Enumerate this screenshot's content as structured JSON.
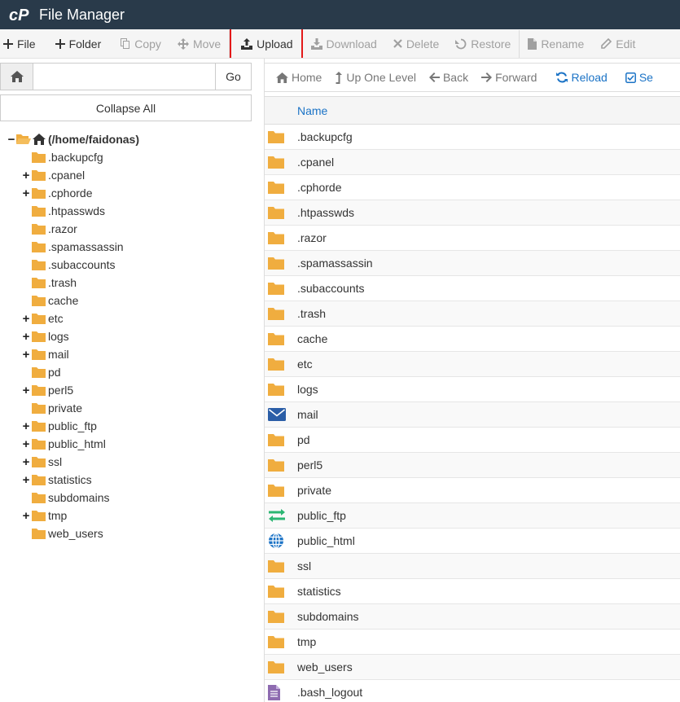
{
  "app": {
    "title": "File Manager"
  },
  "toolbar": {
    "file": "File",
    "folder": "Folder",
    "copy": "Copy",
    "move": "Move",
    "upload": "Upload",
    "download": "Download",
    "delete": "Delete",
    "restore": "Restore",
    "rename": "Rename",
    "edit": "Edit"
  },
  "search": {
    "go": "Go",
    "value": ""
  },
  "collapse_all": "Collapse All",
  "tree": {
    "root": "(/home/faidonas)",
    "items": [
      {
        "label": ".backupcfg",
        "expandable": false
      },
      {
        "label": ".cpanel",
        "expandable": true
      },
      {
        "label": ".cphorde",
        "expandable": true
      },
      {
        "label": ".htpasswds",
        "expandable": false
      },
      {
        "label": ".razor",
        "expandable": false
      },
      {
        "label": ".spamassassin",
        "expandable": false
      },
      {
        "label": ".subaccounts",
        "expandable": false
      },
      {
        "label": ".trash",
        "expandable": false
      },
      {
        "label": "cache",
        "expandable": false
      },
      {
        "label": "etc",
        "expandable": true
      },
      {
        "label": "logs",
        "expandable": true
      },
      {
        "label": "mail",
        "expandable": true
      },
      {
        "label": "pd",
        "expandable": false
      },
      {
        "label": "perl5",
        "expandable": true
      },
      {
        "label": "private",
        "expandable": false
      },
      {
        "label": "public_ftp",
        "expandable": true
      },
      {
        "label": "public_html",
        "expandable": true
      },
      {
        "label": "ssl",
        "expandable": true
      },
      {
        "label": "statistics",
        "expandable": true
      },
      {
        "label": "subdomains",
        "expandable": false
      },
      {
        "label": "tmp",
        "expandable": true
      },
      {
        "label": "web_users",
        "expandable": false
      }
    ]
  },
  "nav": {
    "home": "Home",
    "up": "Up One Level",
    "back": "Back",
    "forward": "Forward",
    "reload": "Reload",
    "select": "Se"
  },
  "table": {
    "header_name": "Name",
    "rows": [
      {
        "name": ".backupcfg",
        "icon": "folder-icon"
      },
      {
        "name": ".cpanel",
        "icon": "folder-icon"
      },
      {
        "name": ".cphorde",
        "icon": "folder-icon"
      },
      {
        "name": ".htpasswds",
        "icon": "folder-icon"
      },
      {
        "name": ".razor",
        "icon": "folder-icon"
      },
      {
        "name": ".spamassassin",
        "icon": "folder-icon"
      },
      {
        "name": ".subaccounts",
        "icon": "folder-icon"
      },
      {
        "name": ".trash",
        "icon": "folder-icon"
      },
      {
        "name": "cache",
        "icon": "folder-icon"
      },
      {
        "name": "etc",
        "icon": "folder-icon"
      },
      {
        "name": "logs",
        "icon": "folder-icon"
      },
      {
        "name": "mail",
        "icon": "mail-icon"
      },
      {
        "name": "pd",
        "icon": "folder-icon"
      },
      {
        "name": "perl5",
        "icon": "folder-icon"
      },
      {
        "name": "private",
        "icon": "folder-icon"
      },
      {
        "name": "public_ftp",
        "icon": "ftp-arrows-icon"
      },
      {
        "name": "public_html",
        "icon": "globe-icon"
      },
      {
        "name": "ssl",
        "icon": "folder-icon"
      },
      {
        "name": "statistics",
        "icon": "folder-icon"
      },
      {
        "name": "subdomains",
        "icon": "folder-icon"
      },
      {
        "name": "tmp",
        "icon": "folder-icon"
      },
      {
        "name": "web_users",
        "icon": "folder-icon"
      },
      {
        "name": ".bash_logout",
        "icon": "text-file-icon"
      }
    ]
  },
  "colors": {
    "titlebar": "#293a4a",
    "folder": "#f0ad3f",
    "link": "#1b73c6",
    "highlight": "#e31919"
  }
}
